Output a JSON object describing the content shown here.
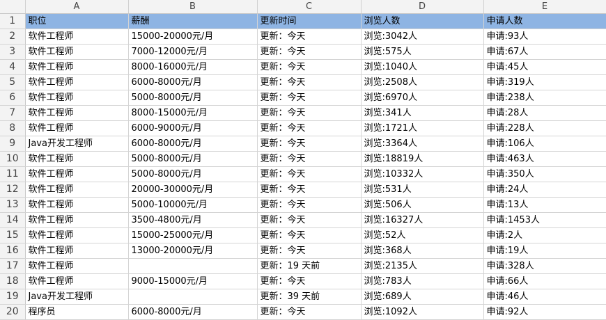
{
  "columns": [
    "A",
    "B",
    "C",
    "D",
    "E"
  ],
  "rows": [
    {
      "n": "1",
      "a": "职位",
      "b": "薪酬",
      "c": "更新时间",
      "d": "浏览人数",
      "e": "申请人数"
    },
    {
      "n": "2",
      "a": "软件工程师",
      "b": "15000-20000元/月",
      "c": "更新：今天",
      "d": "浏览:3042人",
      "e": "申请:93人"
    },
    {
      "n": "3",
      "a": "软件工程师",
      "b": "7000-12000元/月",
      "c": "更新：今天",
      "d": "浏览:575人",
      "e": "申请:67人"
    },
    {
      "n": "4",
      "a": "软件工程师",
      "b": "8000-16000元/月",
      "c": "更新：今天",
      "d": "浏览:1040人",
      "e": "申请:45人"
    },
    {
      "n": "5",
      "a": "软件工程师",
      "b": "6000-8000元/月",
      "c": "更新：今天",
      "d": "浏览:2508人",
      "e": "申请:319人"
    },
    {
      "n": "6",
      "a": "软件工程师",
      "b": "5000-8000元/月",
      "c": "更新：今天",
      "d": "浏览:6970人",
      "e": "申请:238人"
    },
    {
      "n": "7",
      "a": "软件工程师",
      "b": "8000-15000元/月",
      "c": "更新：今天",
      "d": "浏览:341人",
      "e": "申请:28人"
    },
    {
      "n": "8",
      "a": "软件工程师",
      "b": "6000-9000元/月",
      "c": "更新：今天",
      "d": "浏览:1721人",
      "e": "申请:228人"
    },
    {
      "n": "9",
      "a": "Java开发工程师",
      "b": "6000-8000元/月",
      "c": "更新：今天",
      "d": "浏览:3364人",
      "e": "申请:106人"
    },
    {
      "n": "10",
      "a": "软件工程师",
      "b": "5000-8000元/月",
      "c": "更新：今天",
      "d": "浏览:18819人",
      "e": "申请:463人"
    },
    {
      "n": "11",
      "a": "软件工程师",
      "b": "5000-8000元/月",
      "c": "更新：今天",
      "d": "浏览:10332人",
      "e": "申请:350人"
    },
    {
      "n": "12",
      "a": "软件工程师",
      "b": "20000-30000元/月",
      "c": "更新：今天",
      "d": "浏览:531人",
      "e": "申请:24人"
    },
    {
      "n": "13",
      "a": "软件工程师",
      "b": "5000-10000元/月",
      "c": "更新：今天",
      "d": "浏览:506人",
      "e": "申请:13人"
    },
    {
      "n": "14",
      "a": "软件工程师",
      "b": "3500-4800元/月",
      "c": "更新：今天",
      "d": "浏览:16327人",
      "e": "申请:1453人"
    },
    {
      "n": "15",
      "a": "软件工程师",
      "b": "15000-25000元/月",
      "c": "更新：今天",
      "d": "浏览:52人",
      "e": "申请:2人"
    },
    {
      "n": "16",
      "a": "软件工程师",
      "b": "13000-20000元/月",
      "c": "更新：今天",
      "d": "浏览:368人",
      "e": "申请:19人"
    },
    {
      "n": "17",
      "a": "软件工程师",
      "b": "",
      "c": "更新：19 天前",
      "d": "浏览:2135人",
      "e": "申请:328人"
    },
    {
      "n": "18",
      "a": "软件工程师",
      "b": "9000-15000元/月",
      "c": "更新：今天",
      "d": "浏览:783人",
      "e": "申请:66人"
    },
    {
      "n": "19",
      "a": "Java开发工程师",
      "b": "",
      "c": "更新：39 天前",
      "d": "浏览:689人",
      "e": "申请:46人"
    },
    {
      "n": "20",
      "a": "程序员",
      "b": "6000-8000元/月",
      "c": "更新：今天",
      "d": "浏览:1092人",
      "e": "申请:92人"
    }
  ],
  "colors": {
    "header_fill": "#8eb4e3",
    "gridline": "#d4d4d4",
    "heading_bg": "#f3f3f3"
  }
}
